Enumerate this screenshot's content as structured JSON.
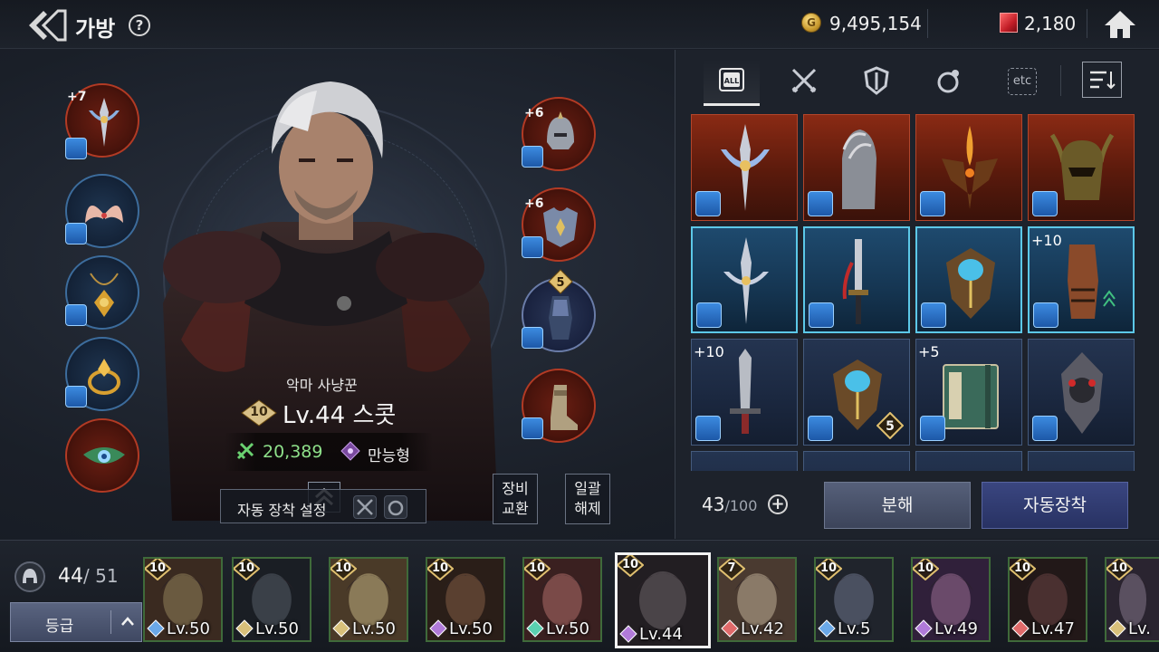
{
  "header": {
    "title": "가방",
    "help_symbol": "?",
    "gold_symbol": "G",
    "gold": "9,495,154",
    "gems": "2,180"
  },
  "hero": {
    "class_name": "악마 사냥꾼",
    "tier": "10",
    "level_name": "Lv.44 스콧",
    "power": "20,389",
    "role": "만능형"
  },
  "equip_slots": {
    "left": [
      {
        "plus": "+7",
        "frame": "red",
        "icon": "trident-weapon-icon"
      },
      {
        "plus": "",
        "frame": "blue",
        "icon": "wings-icon"
      },
      {
        "plus": "",
        "frame": "blue",
        "icon": "amulet-icon"
      },
      {
        "plus": "",
        "frame": "blue",
        "icon": "ring-icon"
      },
      {
        "plus": "",
        "frame": "red",
        "icon": "emblem-icon"
      }
    ],
    "right": [
      {
        "plus": "+6",
        "frame": "red",
        "icon": "helmet-icon"
      },
      {
        "plus": "+6",
        "frame": "red",
        "icon": "armor-icon"
      },
      {
        "plus": "",
        "frame": "purple",
        "tier": "5",
        "icon": "gauntlet-icon"
      },
      {
        "plus": "",
        "frame": "red",
        "icon": "boots-icon"
      }
    ]
  },
  "controls": {
    "auto_equip_setting": "자동 장착 설정",
    "swap_equip_l1": "장비",
    "swap_equip_l2": "교환",
    "bulk_unequip_l1": "일괄",
    "bulk_unequip_l2": "해제"
  },
  "inventory": {
    "tabs": [
      "ALL",
      "weapon",
      "armor",
      "accessory",
      "etc"
    ],
    "etc_label": "etc",
    "all_label": "ALL",
    "count": "43",
    "max": "/100",
    "add_symbol": "+",
    "dismantle": "분해",
    "auto_equip": "자동장착",
    "items": [
      {
        "frame": "red",
        "plus": "",
        "icon": "trident-weapon-icon"
      },
      {
        "frame": "red",
        "plus": "",
        "icon": "claw-gauntlet-icon"
      },
      {
        "frame": "red",
        "plus": "",
        "icon": "flame-armor-icon"
      },
      {
        "frame": "red",
        "plus": "",
        "icon": "horned-helmet-icon"
      },
      {
        "frame": "blue",
        "plus": "",
        "icon": "trident-weapon-icon"
      },
      {
        "frame": "blue",
        "plus": "",
        "icon": "katana-icon"
      },
      {
        "frame": "blue",
        "plus": "",
        "icon": "orb-armor-icon"
      },
      {
        "frame": "blue",
        "plus": "+10",
        "icon": "gauntlet-icon"
      },
      {
        "frame": "navy",
        "plus": "+10",
        "icon": "sword-icon"
      },
      {
        "frame": "navy",
        "plus": "",
        "tier": "5",
        "icon": "orb-armor-icon"
      },
      {
        "frame": "navy",
        "plus": "+5",
        "icon": "book-icon"
      },
      {
        "frame": "navy",
        "plus": "",
        "icon": "spiked-shield-icon"
      }
    ]
  },
  "roster": {
    "count": "44",
    "max": "/ 51",
    "grade_label": "등급",
    "heroes": [
      {
        "tier": "10",
        "level": "Lv.50",
        "role_color": "#6aa8e8"
      },
      {
        "tier": "10",
        "level": "Lv.50",
        "role_color": "#d8c07a"
      },
      {
        "tier": "10",
        "level": "Lv.50",
        "role_color": "#d8c07a"
      },
      {
        "tier": "10",
        "level": "Lv.50",
        "role_color": "#b07ad8"
      },
      {
        "tier": "10",
        "level": "Lv.50",
        "role_color": "#5ad0b0"
      },
      {
        "tier": "10",
        "level": "Lv.44",
        "role_color": "#b07ad8"
      },
      {
        "tier": "7",
        "level": "Lv.42",
        "role_color": "#e06a6a"
      },
      {
        "tier": "10",
        "level": "Lv.5",
        "role_color": "#6aa8e8"
      },
      {
        "tier": "10",
        "level": "Lv.49",
        "role_color": "#b07ad8"
      },
      {
        "tier": "10",
        "level": "Lv.47",
        "role_color": "#e06a6a"
      },
      {
        "tier": "10",
        "level": "Lv.",
        "role_color": "#d8c07a"
      }
    ]
  }
}
